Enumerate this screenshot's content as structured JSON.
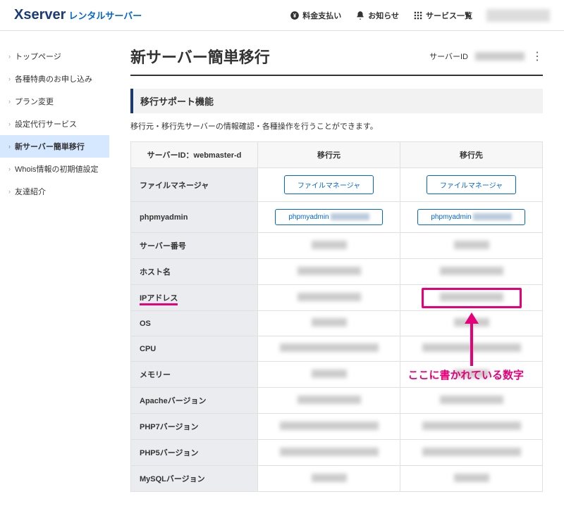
{
  "header": {
    "logo_main": "Xserver",
    "logo_sub": "レンタルサーバー",
    "nav": {
      "payment": "料金支払い",
      "notice": "お知らせ",
      "services": "サービス一覧"
    }
  },
  "sidebar": {
    "items": [
      {
        "label": "トップページ"
      },
      {
        "label": "各種特典のお申し込み"
      },
      {
        "label": "プラン変更"
      },
      {
        "label": "設定代行サービス"
      },
      {
        "label": "新サーバー簡単移行"
      },
      {
        "label": "Whois情報の初期値設定"
      },
      {
        "label": "友達紹介"
      }
    ]
  },
  "page": {
    "title": "新サーバー簡単移行",
    "server_id_label": "サーバーID",
    "section_title": "移行サポート機能",
    "desc": "移行元・移行先サーバーの情報確認・各種操作を行うことができます。"
  },
  "table": {
    "head_server": "サーバーID：webmaster-d",
    "head_src": "移行元",
    "head_dst": "移行先",
    "rows": {
      "file_manager": "ファイルマネージャ",
      "phpmyadmin": "phpmyadmin",
      "server_no": "サーバー番号",
      "host": "ホスト名",
      "ip": "IPアドレス",
      "os": "OS",
      "cpu": "CPU",
      "memory": "メモリー",
      "apache": "Apacheバージョン",
      "php7": "PHP7バージョン",
      "php5": "PHP5バージョン",
      "mysql": "MySQLバージョン"
    },
    "btn_file_manager": "ファイルマネージャ",
    "btn_phpmyadmin_prefix": "phpmyadmin"
  },
  "annotation": "ここに書かれている数字"
}
